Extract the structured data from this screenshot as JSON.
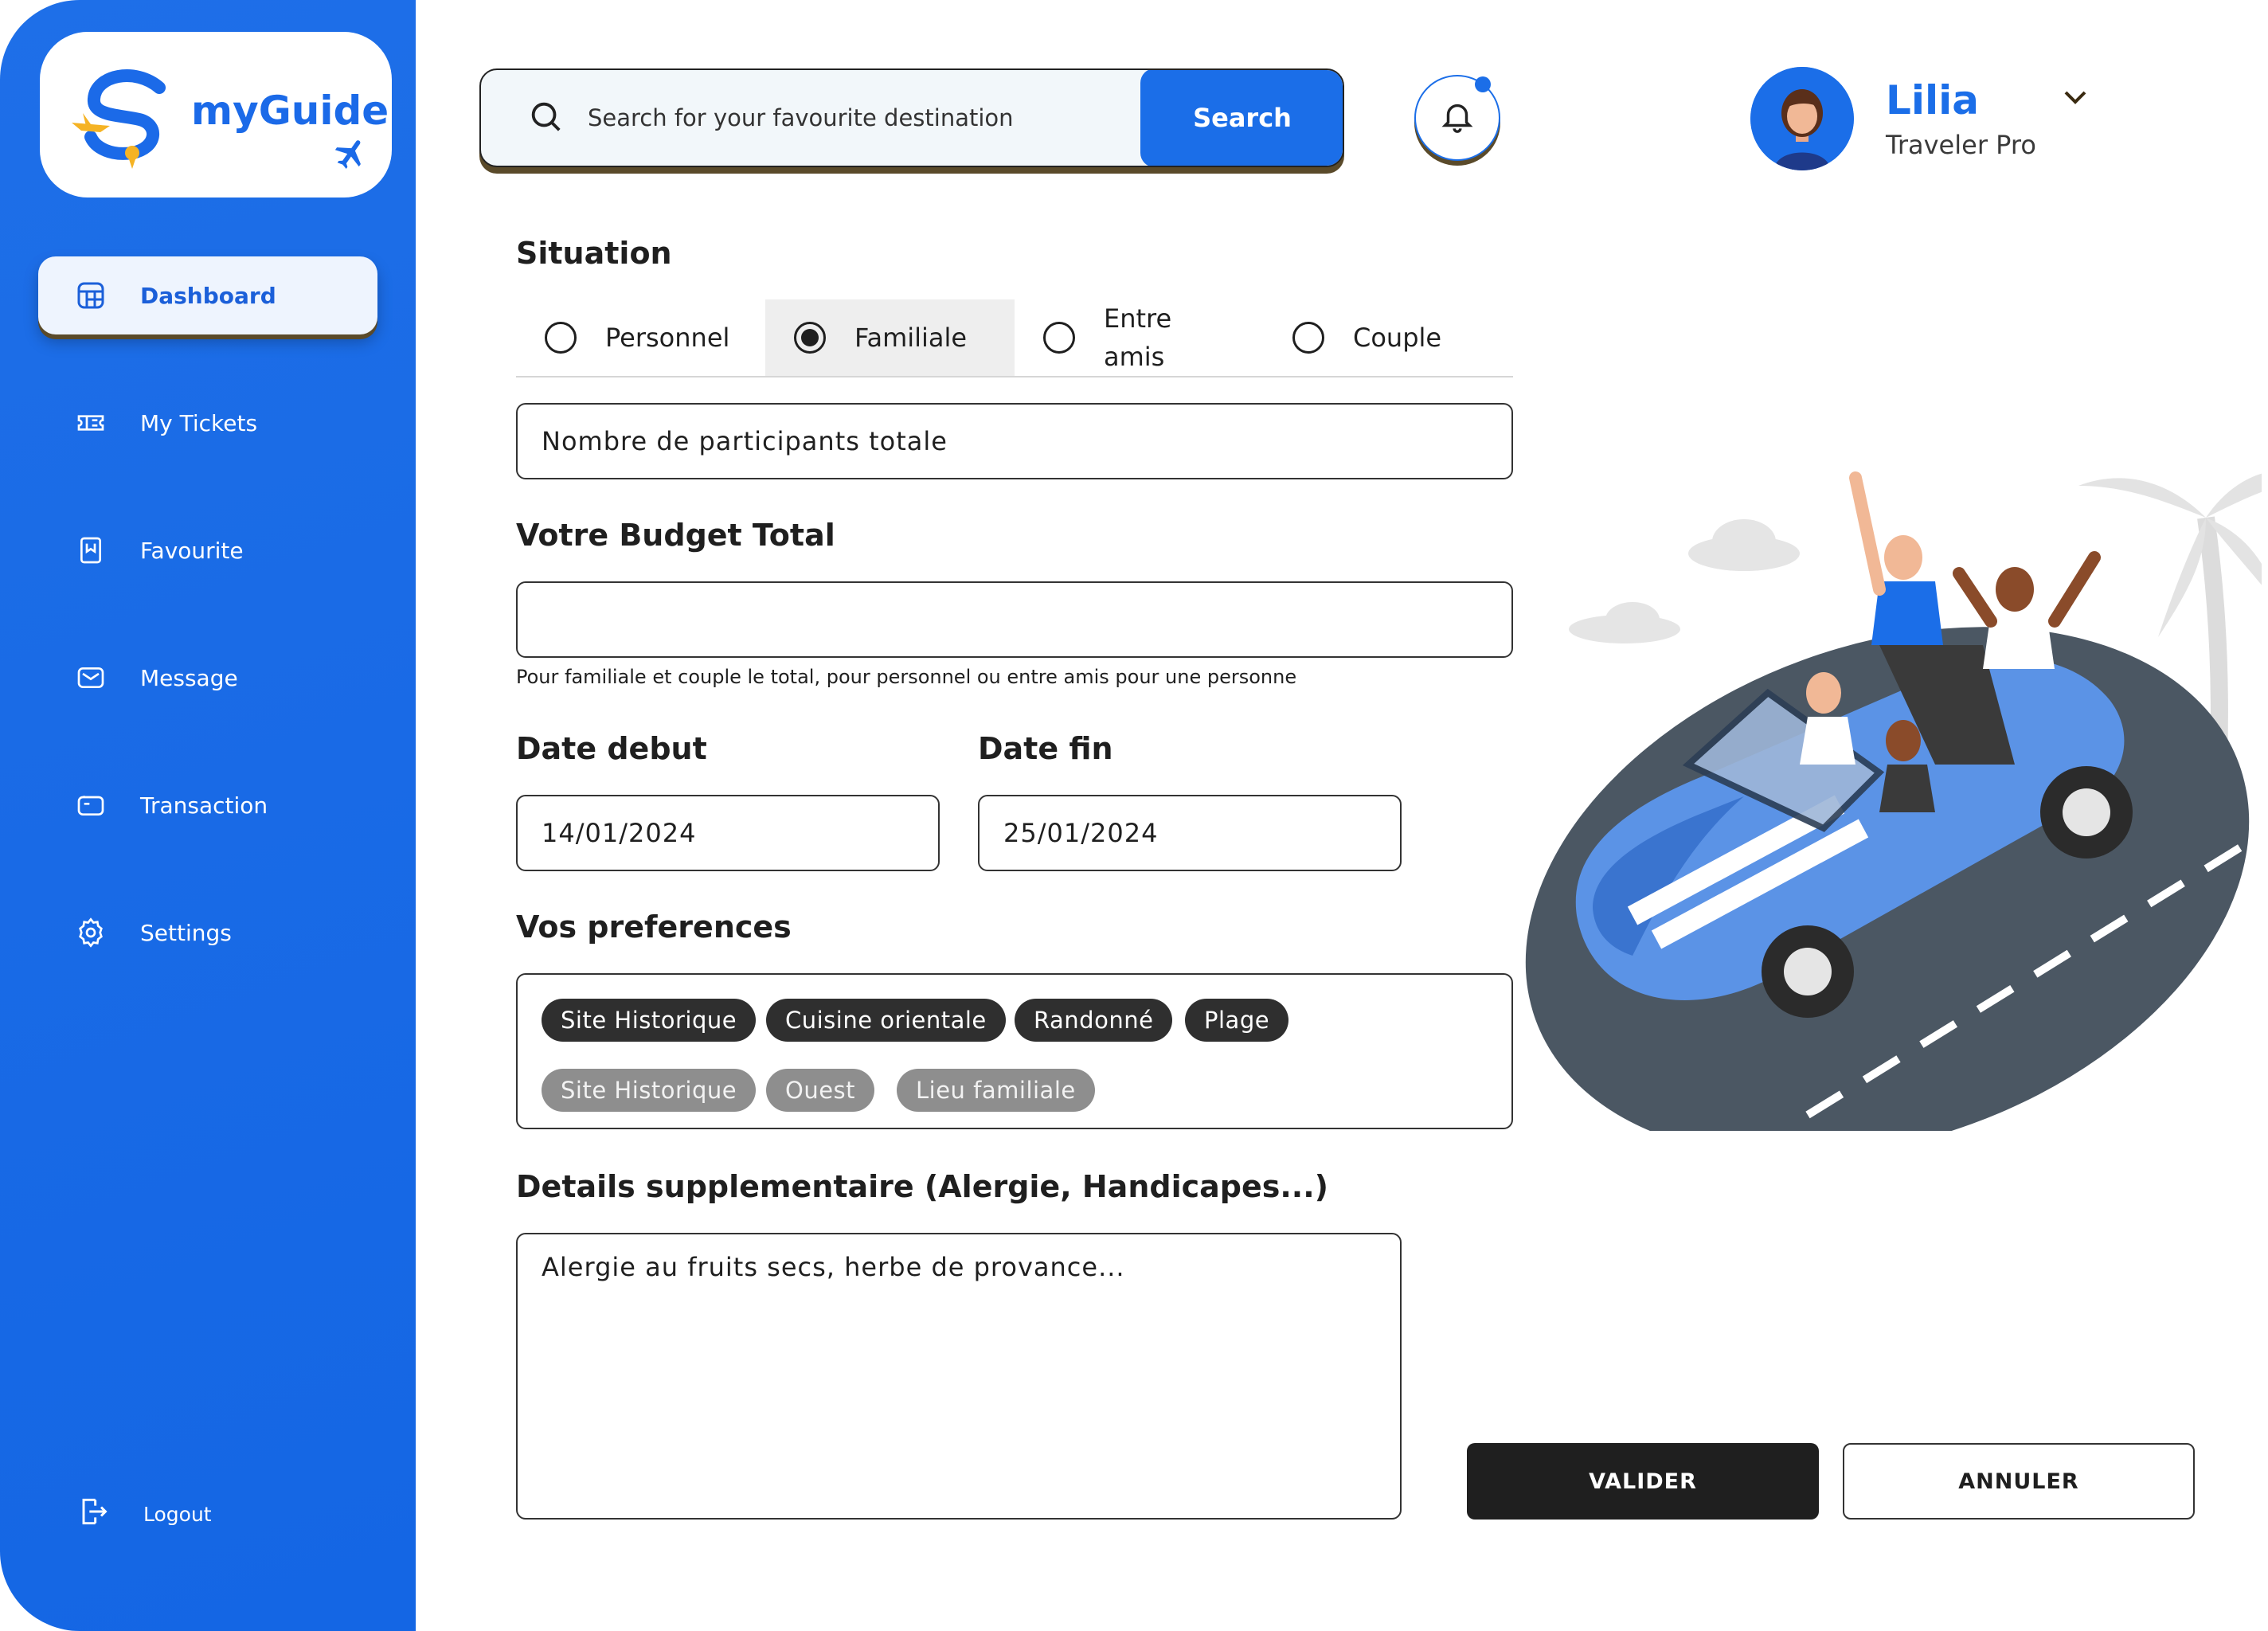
{
  "brand": {
    "name": "myGuide"
  },
  "sidebar": {
    "items": [
      {
        "label": "Dashboard",
        "icon": "grid-icon",
        "active": true
      },
      {
        "label": "My Tickets",
        "icon": "ticket-icon",
        "active": false
      },
      {
        "label": "Favourite",
        "icon": "bookmark-icon",
        "active": false
      },
      {
        "label": "Message",
        "icon": "mail-icon",
        "active": false
      },
      {
        "label": "Transaction",
        "icon": "wallet-icon",
        "active": false
      },
      {
        "label": "Settings",
        "icon": "gear-icon",
        "active": false
      }
    ],
    "logout": "Logout"
  },
  "search": {
    "placeholder": "Search for your favourite destination",
    "button": "Search"
  },
  "profile": {
    "name": "Lilia",
    "role": "Traveler Pro"
  },
  "form": {
    "situation_label": "Situation",
    "situations": [
      {
        "label": "Personnel",
        "selected": false
      },
      {
        "label": "Familiale",
        "selected": true
      },
      {
        "label": "Entre amis",
        "selected": false
      },
      {
        "label": "Couple",
        "selected": false
      }
    ],
    "participants_value": "Nombre de participants totale",
    "budget_label": "Votre Budget Total",
    "budget_value": "",
    "budget_hint": "Pour familiale et couple le total, pour personnel ou entre amis pour une personne",
    "date_start_label": "Date debut",
    "date_start_value": "14/01/2024",
    "date_end_label": "Date fin",
    "date_end_value": "25/01/2024",
    "prefs_label": "Vos preferences",
    "prefs_selected": [
      "Site Historique",
      "Cuisine orientale",
      "Randonné",
      "Plage"
    ],
    "prefs_suggested": [
      "Site Historique",
      "Ouest",
      "Lieu familiale"
    ],
    "details_label": "Details supplementaire (Alergie, Handicapes...)",
    "details_value": "Alergie au fruits secs, herbe de provance..."
  },
  "actions": {
    "validate": "VALIDER",
    "cancel": "ANNULER"
  },
  "colors": {
    "accent": "#1b6ee8",
    "dark": "#1f1f1f",
    "chip_dark": "#2f2f2f",
    "chip_gray": "#8e8e8e"
  }
}
